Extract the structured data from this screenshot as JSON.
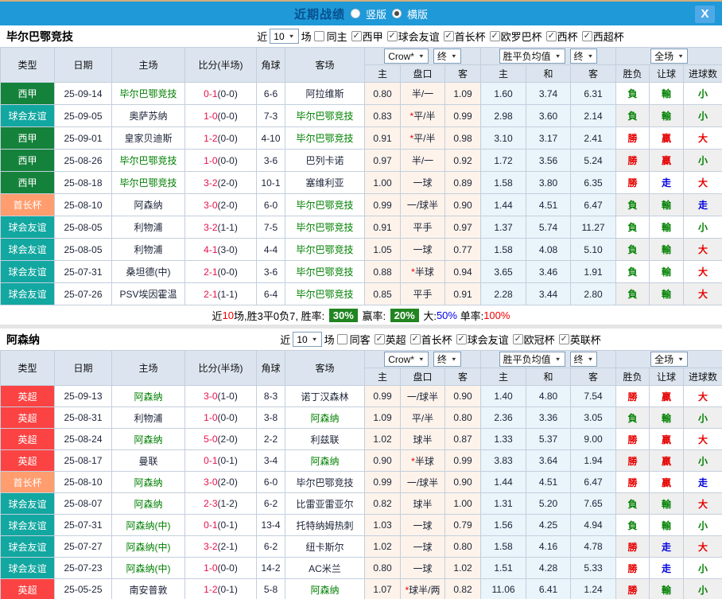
{
  "topbar": {
    "title": "近期战绩",
    "radios": [
      {
        "label": "竖版",
        "selected": false
      },
      {
        "label": "横版",
        "selected": true
      }
    ],
    "close_label": "X"
  },
  "colors": {
    "topbar_bg": "#1f99d8",
    "title_text": "#07508e",
    "league": {
      "西甲": "#15823c",
      "球会友谊": "#12a7a0",
      "首长杯": "#ff9d6e",
      "英超": "#fb4343"
    },
    "team_highlight": "#008000",
    "fulltime_score": "#e8114b",
    "result_red": "#e60000",
    "result_green": "#008000",
    "result_blue": "#0000dd",
    "summary_badge_bg": "#218521",
    "odds_col_bg": "#fdf3ea",
    "avg_col_bg": "#e9f4fb"
  },
  "table_header": {
    "main_cols": [
      "类型",
      "日期",
      "主场",
      "比分(半场)",
      "角球",
      "客场"
    ],
    "dropdowns": {
      "odds_source": "Crow*",
      "final1": "终",
      "avg": "胜平负均值",
      "final2": "终",
      "fullmatch": "全场"
    },
    "sub_cols": [
      "主",
      "盘口",
      "客",
      "主",
      "和",
      "客",
      "胜负",
      "让球",
      "进球数"
    ]
  },
  "sections": [
    {
      "team": "毕尔巴鄂竞技",
      "filter": {
        "prefix": "近",
        "count": "10",
        "suffix": "场",
        "same": {
          "label": "同主",
          "checked": false
        },
        "leagues": [
          {
            "label": "西甲",
            "checked": true
          },
          {
            "label": "球会友谊",
            "checked": true
          },
          {
            "label": "首长杯",
            "checked": true
          },
          {
            "label": "欧罗巴杯",
            "checked": true
          },
          {
            "label": "西杯",
            "checked": true
          },
          {
            "label": "西超杯",
            "checked": true
          }
        ]
      },
      "rows": [
        {
          "league": "西甲",
          "date": "25-09-14",
          "home": "毕尔巴鄂竞技",
          "home_hl": true,
          "ft": "0-1",
          "ht": "(0-0)",
          "corner": "6-6",
          "away": "阿拉维斯",
          "away_hl": false,
          "star": false,
          "o_home": "0.80",
          "handicap": "半/一",
          "o_away": "1.09",
          "avg_win": "1.60",
          "avg_draw": "3.74",
          "avg_loss": "6.31",
          "res": [
            {
              "t": "負",
              "c": "green"
            },
            {
              "t": "輸",
              "c": "green"
            },
            {
              "t": "小",
              "c": "green"
            }
          ]
        },
        {
          "league": "球会友谊",
          "date": "25-09-05",
          "home": "奥萨苏纳",
          "home_hl": false,
          "ft": "1-0",
          "ht": "(0-0)",
          "corner": "7-3",
          "away": "毕尔巴鄂竞技",
          "away_hl": true,
          "star": true,
          "o_home": "0.83",
          "handicap": "平/半",
          "o_away": "0.99",
          "avg_win": "2.98",
          "avg_draw": "3.60",
          "avg_loss": "2.14",
          "res": [
            {
              "t": "負",
              "c": "green"
            },
            {
              "t": "輸",
              "c": "green"
            },
            {
              "t": "小",
              "c": "green"
            }
          ]
        },
        {
          "league": "西甲",
          "date": "25-09-01",
          "home": "皇家贝迪斯",
          "home_hl": false,
          "ft": "1-2",
          "ht": "(0-0)",
          "corner": "4-10",
          "away": "毕尔巴鄂竞技",
          "away_hl": true,
          "star": true,
          "o_home": "0.91",
          "handicap": "平/半",
          "o_away": "0.98",
          "avg_win": "3.10",
          "avg_draw": "3.17",
          "avg_loss": "2.41",
          "res": [
            {
              "t": "勝",
              "c": "red"
            },
            {
              "t": "贏",
              "c": "red"
            },
            {
              "t": "大",
              "c": "red"
            }
          ]
        },
        {
          "league": "西甲",
          "date": "25-08-26",
          "home": "毕尔巴鄂竞技",
          "home_hl": true,
          "ft": "1-0",
          "ht": "(0-0)",
          "corner": "3-6",
          "away": "巴列卡诺",
          "away_hl": false,
          "star": false,
          "o_home": "0.97",
          "handicap": "半/一",
          "o_away": "0.92",
          "avg_win": "1.72",
          "avg_draw": "3.56",
          "avg_loss": "5.24",
          "res": [
            {
              "t": "勝",
              "c": "red"
            },
            {
              "t": "贏",
              "c": "red"
            },
            {
              "t": "小",
              "c": "green"
            }
          ]
        },
        {
          "league": "西甲",
          "date": "25-08-18",
          "home": "毕尔巴鄂竞技",
          "home_hl": true,
          "ft": "3-2",
          "ht": "(2-0)",
          "corner": "10-1",
          "away": "塞维利亚",
          "away_hl": false,
          "star": false,
          "o_home": "1.00",
          "handicap": "一球",
          "o_away": "0.89",
          "avg_win": "1.58",
          "avg_draw": "3.80",
          "avg_loss": "6.35",
          "res": [
            {
              "t": "勝",
              "c": "red"
            },
            {
              "t": "走",
              "c": "blue"
            },
            {
              "t": "大",
              "c": "red"
            }
          ]
        },
        {
          "league": "首长杯",
          "date": "25-08-10",
          "home": "阿森纳",
          "home_hl": false,
          "ft": "3-0",
          "ht": "(2-0)",
          "corner": "6-0",
          "away": "毕尔巴鄂竞技",
          "away_hl": true,
          "star": false,
          "o_home": "0.99",
          "handicap": "一/球半",
          "o_away": "0.90",
          "avg_win": "1.44",
          "avg_draw": "4.51",
          "avg_loss": "6.47",
          "res": [
            {
              "t": "負",
              "c": "green"
            },
            {
              "t": "輸",
              "c": "green"
            },
            {
              "t": "走",
              "c": "blue"
            }
          ]
        },
        {
          "league": "球会友谊",
          "date": "25-08-05",
          "home": "利物浦",
          "home_hl": false,
          "ft": "3-2",
          "ht": "(1-1)",
          "corner": "7-5",
          "away": "毕尔巴鄂竞技",
          "away_hl": true,
          "star": false,
          "o_home": "0.91",
          "handicap": "平手",
          "o_away": "0.97",
          "avg_win": "1.37",
          "avg_draw": "5.74",
          "avg_loss": "11.27",
          "res": [
            {
              "t": "負",
              "c": "green"
            },
            {
              "t": "輸",
              "c": "green"
            },
            {
              "t": "小",
              "c": "green"
            }
          ]
        },
        {
          "league": "球会友谊",
          "date": "25-08-05",
          "home": "利物浦",
          "home_hl": false,
          "ft": "4-1",
          "ht": "(3-0)",
          "corner": "4-4",
          "away": "毕尔巴鄂竞技",
          "away_hl": true,
          "star": false,
          "o_home": "1.05",
          "handicap": "一球",
          "o_away": "0.77",
          "avg_win": "1.58",
          "avg_draw": "4.08",
          "avg_loss": "5.10",
          "res": [
            {
              "t": "負",
              "c": "green"
            },
            {
              "t": "輸",
              "c": "green"
            },
            {
              "t": "大",
              "c": "red"
            }
          ]
        },
        {
          "league": "球会友谊",
          "date": "25-07-31",
          "home": "桑坦德(中)",
          "home_hl": false,
          "ft": "2-1",
          "ht": "(0-0)",
          "corner": "3-6",
          "away": "毕尔巴鄂竞技",
          "away_hl": true,
          "star": true,
          "o_home": "0.88",
          "handicap": "半球",
          "o_away": "0.94",
          "avg_win": "3.65",
          "avg_draw": "3.46",
          "avg_loss": "1.91",
          "res": [
            {
              "t": "負",
              "c": "green"
            },
            {
              "t": "輸",
              "c": "green"
            },
            {
              "t": "大",
              "c": "red"
            }
          ]
        },
        {
          "league": "球会友谊",
          "date": "25-07-26",
          "home": "PSV埃因霍温",
          "home_hl": false,
          "ft": "2-1",
          "ht": "(1-1)",
          "corner": "6-4",
          "away": "毕尔巴鄂竞技",
          "away_hl": true,
          "star": false,
          "o_home": "0.85",
          "handicap": "平手",
          "o_away": "0.91",
          "avg_win": "2.28",
          "avg_draw": "3.44",
          "avg_loss": "2.80",
          "res": [
            {
              "t": "負",
              "c": "green"
            },
            {
              "t": "輸",
              "c": "green"
            },
            {
              "t": "大",
              "c": "red"
            }
          ]
        }
      ],
      "summary": [
        {
          "t": "近"
        },
        {
          "t": "10",
          "c": "red"
        },
        {
          "t": "场,胜3平0负7, "
        },
        {
          "t": "胜率: "
        },
        {
          "t": "30%",
          "badge": true
        },
        {
          "t": " 赢率: "
        },
        {
          "t": "20%",
          "badge": true
        },
        {
          "t": " 大:"
        },
        {
          "t": "50%",
          "c": "blue"
        },
        {
          "t": " 单率:"
        },
        {
          "t": "100%",
          "c": "red"
        }
      ]
    },
    {
      "team": "阿森纳",
      "filter": {
        "prefix": "近",
        "count": "10",
        "suffix": "场",
        "same": {
          "label": "同客",
          "checked": false
        },
        "leagues": [
          {
            "label": "英超",
            "checked": true
          },
          {
            "label": "首长杯",
            "checked": true
          },
          {
            "label": "球会友谊",
            "checked": true
          },
          {
            "label": "欧冠杯",
            "checked": true
          },
          {
            "label": "英联杯",
            "checked": true
          }
        ]
      },
      "rows": [
        {
          "league": "英超",
          "date": "25-09-13",
          "home": "阿森纳",
          "home_hl": true,
          "ft": "3-0",
          "ht": "(1-0)",
          "corner": "8-3",
          "away": "诺丁汉森林",
          "away_hl": false,
          "star": false,
          "o_home": "0.99",
          "handicap": "一/球半",
          "o_away": "0.90",
          "avg_win": "1.40",
          "avg_draw": "4.80",
          "avg_loss": "7.54",
          "res": [
            {
              "t": "勝",
              "c": "red"
            },
            {
              "t": "贏",
              "c": "red"
            },
            {
              "t": "大",
              "c": "red"
            }
          ]
        },
        {
          "league": "英超",
          "date": "25-08-31",
          "home": "利物浦",
          "home_hl": false,
          "ft": "1-0",
          "ht": "(0-0)",
          "corner": "3-8",
          "away": "阿森纳",
          "away_hl": true,
          "star": false,
          "o_home": "1.09",
          "handicap": "平/半",
          "o_away": "0.80",
          "avg_win": "2.36",
          "avg_draw": "3.36",
          "avg_loss": "3.05",
          "res": [
            {
              "t": "負",
              "c": "green"
            },
            {
              "t": "輸",
              "c": "green"
            },
            {
              "t": "小",
              "c": "green"
            }
          ]
        },
        {
          "league": "英超",
          "date": "25-08-24",
          "home": "阿森纳",
          "home_hl": true,
          "ft": "5-0",
          "ht": "(2-0)",
          "corner": "2-2",
          "away": "利兹联",
          "away_hl": false,
          "star": false,
          "o_home": "1.02",
          "handicap": "球半",
          "o_away": "0.87",
          "avg_win": "1.33",
          "avg_draw": "5.37",
          "avg_loss": "9.00",
          "res": [
            {
              "t": "勝",
              "c": "red"
            },
            {
              "t": "贏",
              "c": "red"
            },
            {
              "t": "大",
              "c": "red"
            }
          ]
        },
        {
          "league": "英超",
          "date": "25-08-17",
          "home": "曼联",
          "home_hl": false,
          "ft": "0-1",
          "ht": "(0-1)",
          "corner": "3-4",
          "away": "阿森纳",
          "away_hl": true,
          "star": true,
          "o_home": "0.90",
          "handicap": "半球",
          "o_away": "0.99",
          "avg_win": "3.83",
          "avg_draw": "3.64",
          "avg_loss": "1.94",
          "res": [
            {
              "t": "勝",
              "c": "red"
            },
            {
              "t": "贏",
              "c": "red"
            },
            {
              "t": "小",
              "c": "green"
            }
          ]
        },
        {
          "league": "首长杯",
          "date": "25-08-10",
          "home": "阿森纳",
          "home_hl": true,
          "ft": "3-0",
          "ht": "(2-0)",
          "corner": "6-0",
          "away": "毕尔巴鄂竞技",
          "away_hl": false,
          "star": false,
          "o_home": "0.99",
          "handicap": "一/球半",
          "o_away": "0.90",
          "avg_win": "1.44",
          "avg_draw": "4.51",
          "avg_loss": "6.47",
          "res": [
            {
              "t": "勝",
              "c": "red"
            },
            {
              "t": "贏",
              "c": "red"
            },
            {
              "t": "走",
              "c": "blue"
            }
          ]
        },
        {
          "league": "球会友谊",
          "date": "25-08-07",
          "home": "阿森纳",
          "home_hl": true,
          "ft": "2-3",
          "ht": "(1-2)",
          "corner": "6-2",
          "away": "比雷亚雷亚尔",
          "away_hl": false,
          "star": false,
          "o_home": "0.82",
          "handicap": "球半",
          "o_away": "1.00",
          "avg_win": "1.31",
          "avg_draw": "5.20",
          "avg_loss": "7.65",
          "res": [
            {
              "t": "負",
              "c": "green"
            },
            {
              "t": "輸",
              "c": "green"
            },
            {
              "t": "大",
              "c": "red"
            }
          ]
        },
        {
          "league": "球会友谊",
          "date": "25-07-31",
          "home": "阿森纳(中)",
          "home_hl": true,
          "ft": "0-1",
          "ht": "(0-1)",
          "corner": "13-4",
          "away": "托特纳姆热刺",
          "away_hl": false,
          "star": false,
          "o_home": "1.03",
          "handicap": "一球",
          "o_away": "0.79",
          "avg_win": "1.56",
          "avg_draw": "4.25",
          "avg_loss": "4.94",
          "res": [
            {
              "t": "負",
              "c": "green"
            },
            {
              "t": "輸",
              "c": "green"
            },
            {
              "t": "小",
              "c": "green"
            }
          ]
        },
        {
          "league": "球会友谊",
          "date": "25-07-27",
          "home": "阿森纳(中)",
          "home_hl": true,
          "ft": "3-2",
          "ht": "(2-1)",
          "corner": "6-2",
          "away": "纽卡斯尔",
          "away_hl": false,
          "star": false,
          "o_home": "1.02",
          "handicap": "一球",
          "o_away": "0.80",
          "avg_win": "1.58",
          "avg_draw": "4.16",
          "avg_loss": "4.78",
          "res": [
            {
              "t": "勝",
              "c": "red"
            },
            {
              "t": "走",
              "c": "blue"
            },
            {
              "t": "大",
              "c": "red"
            }
          ]
        },
        {
          "league": "球会友谊",
          "date": "25-07-23",
          "home": "阿森纳(中)",
          "home_hl": true,
          "ft": "1-0",
          "ht": "(0-0)",
          "corner": "14-2",
          "away": "AC米兰",
          "away_hl": false,
          "star": false,
          "o_home": "0.80",
          "handicap": "一球",
          "o_away": "1.02",
          "avg_win": "1.51",
          "avg_draw": "4.28",
          "avg_loss": "5.33",
          "res": [
            {
              "t": "勝",
              "c": "red"
            },
            {
              "t": "走",
              "c": "blue"
            },
            {
              "t": "小",
              "c": "green"
            }
          ]
        },
        {
          "league": "英超",
          "date": "25-05-25",
          "home": "南安普敦",
          "home_hl": false,
          "ft": "1-2",
          "ht": "(0-1)",
          "corner": "5-8",
          "away": "阿森纳",
          "away_hl": true,
          "star": true,
          "o_home": "1.07",
          "handicap": "球半/两",
          "o_away": "0.82",
          "avg_win": "11.06",
          "avg_draw": "6.41",
          "avg_loss": "1.24",
          "res": [
            {
              "t": "勝",
              "c": "red"
            },
            {
              "t": "輸",
              "c": "green"
            },
            {
              "t": "小",
              "c": "green"
            }
          ]
        }
      ],
      "summary": null
    }
  ]
}
